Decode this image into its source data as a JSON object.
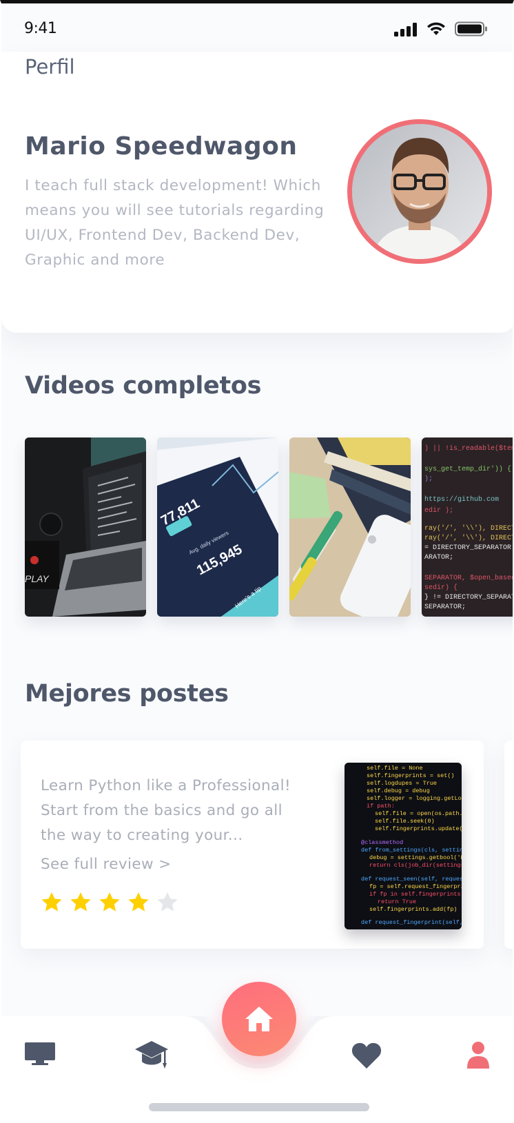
{
  "status_bar": {
    "time": "9:41"
  },
  "page": {
    "title": "Perfil"
  },
  "profile": {
    "name": "Mario Speedwagon",
    "bio": "I teach full stack development! Which means you will see tutorials regarding UI/UX, Frontend Dev, Backend Dev, Graphic and more"
  },
  "videos": {
    "heading": "Videos completos",
    "thumbs": [
      {
        "name": "laptop-code-thumb"
      },
      {
        "name": "analytics-dashboard-thumb",
        "stats": [
          "77,811",
          "115,945",
          "Avg. daily viewers",
          "Here's a tip"
        ]
      },
      {
        "name": "stationery-phone-thumb"
      },
      {
        "name": "php-code-thumb"
      }
    ]
  },
  "posts": {
    "heading": "Mejores postes",
    "items": [
      {
        "text": "Learn Python like a Professional! Start from the basics and go all the way to creating your...",
        "link": "See full review >",
        "rating": 4,
        "max_rating": 5
      }
    ]
  },
  "colors": {
    "accent": "#f06f76",
    "heading": "#4f586a",
    "muted": "#b3b7c2",
    "star_on": "#ffd000",
    "star_off": "#e4e6ea"
  },
  "nav": {
    "items": [
      "monitor-icon",
      "graduation-cap-icon",
      "home-icon",
      "heart-icon",
      "user-icon"
    ],
    "active": "user-icon"
  }
}
